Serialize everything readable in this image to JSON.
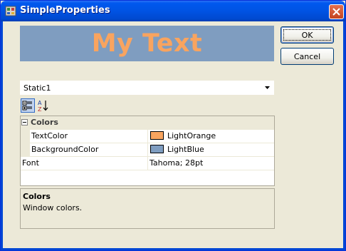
{
  "window": {
    "title": "SimpleProperties"
  },
  "preview": {
    "text": "My Text",
    "text_color": "#F9A45F",
    "background_color": "#7F9DC0"
  },
  "buttons": {
    "ok_label": "OK",
    "cancel_label": "Cancel"
  },
  "object_selector": {
    "selected": "Static1"
  },
  "toolbar": {
    "categorized_icon": "categorized-icon",
    "alphabetical_icon": "alphabetical-sort-icon"
  },
  "grid": {
    "category": {
      "label": "Colors",
      "expanded": true
    },
    "properties": [
      {
        "name": "TextColor",
        "value": "LightOrange",
        "swatch": "#F9A45F"
      },
      {
        "name": "BackgroundColor",
        "value": "LightBlue",
        "swatch": "#7F9DC0"
      },
      {
        "name": "Font",
        "value": "Tahoma; 28pt"
      }
    ]
  },
  "description": {
    "title": "Colors",
    "text": "Window colors."
  }
}
